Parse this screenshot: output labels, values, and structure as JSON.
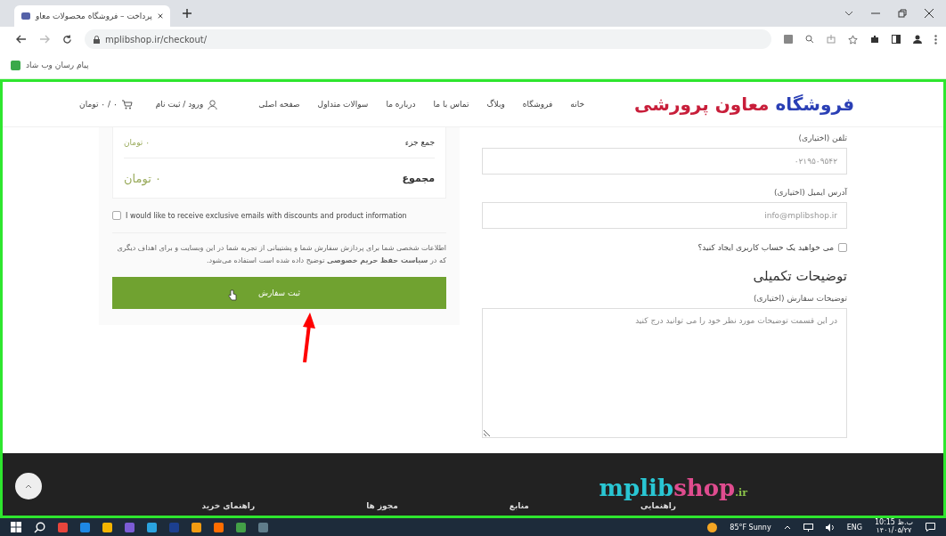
{
  "browser": {
    "tab_title": "پرداخت – فروشگاه محصولات معاو",
    "url": "mplibshop.ir/checkout/",
    "bookmarks": [
      "پیام رسان وب شاد"
    ]
  },
  "header": {
    "logo": {
      "first": "فروشگاه",
      "second": "معاون پرورشی"
    },
    "nav": [
      "خانه",
      "فروشگاه",
      "وبلاگ",
      "تماس با ما",
      "درباره ما",
      "سوالات متداول",
      "صفحه اصلی"
    ],
    "account": "ورود / ثبت نام",
    "cart": "۰ / ۰ تومان"
  },
  "form": {
    "fields": [
      {
        "label": "تلفن (اختیاری)",
        "value": "۰۲۱۹۵۰۹۵۴۲"
      },
      {
        "label": "آدرس ایمیل (اختیاری)",
        "value": "info@mplibshop.ir"
      }
    ],
    "create_account": {
      "label": "می خواهید یک حساب کاربری ایجاد کنید؟",
      "checked": false
    },
    "section_title": "توضیحات تکمیلی",
    "notes_label": "توضیحات سفارش (اختیاری)",
    "notes_placeholder": "در این قسمت توضیحات مورد نظر خود را می توانید درج کنید"
  },
  "order": {
    "rows": [
      {
        "label": "جمع جزء",
        "value": "۰ تومان",
        "kind": "subtotal"
      },
      {
        "label": "مجموع",
        "value": "۰ تومان",
        "kind": "total"
      }
    ],
    "newsletter": {
      "label": "I would like to receive exclusive emails with discounts and product information",
      "checked": false
    },
    "privacy": "اطلاعات شخصی شما برای پردازش سفارش شما و پشتیبانی از تجربه شما در این وبسایت و برای اهداف دیگری که در **سیاست حفظ حریم خصوصی** توضیح داده شده است استفاده می‌شود.",
    "button": "ثبت سفارش"
  },
  "footer": {
    "logo": {
      "main": "mplib",
      "accent": "shop",
      "suffix": ".ir"
    },
    "headings": [
      "راهنمایی",
      "منابع",
      "مجوز ها",
      "راهنمای خرید"
    ]
  },
  "taskbar": {
    "apps": [
      {
        "color": "#e8453c"
      },
      {
        "color": "#1e88e5"
      },
      {
        "color": "#f4b400"
      },
      {
        "color": "#7b5cd6"
      },
      {
        "color": "#2aa3e0"
      },
      {
        "color": "#1c3f8f"
      },
      {
        "color": "#f39c12"
      },
      {
        "color": "#ff6d00"
      },
      {
        "color": "#43a047"
      },
      {
        "color": "#607d8b"
      }
    ],
    "weather": "85°F Sunny",
    "language": "ENG",
    "time": "10:15 ب.ظ",
    "date": "۱۴۰۱/۰۵/۲۷"
  }
}
